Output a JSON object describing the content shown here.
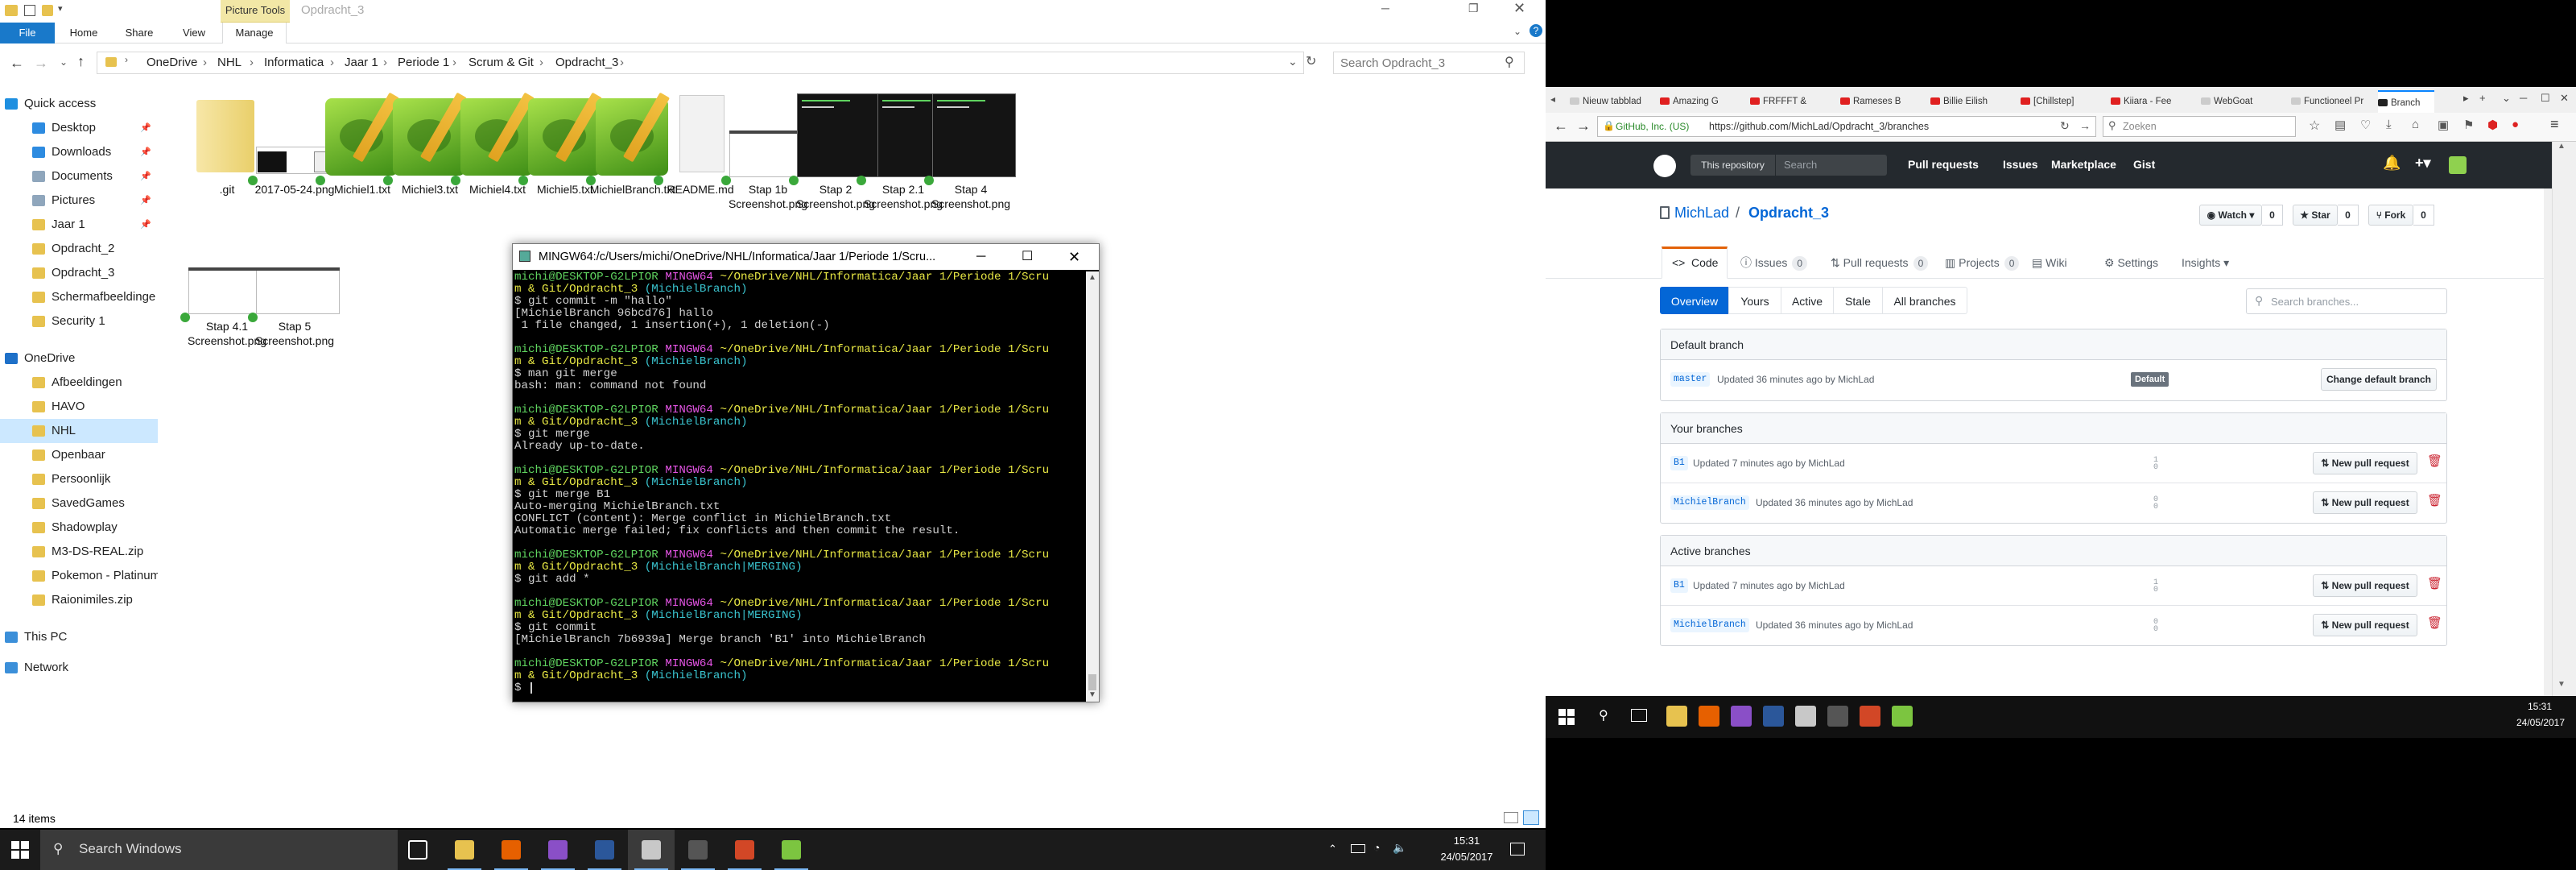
{
  "explorer": {
    "quick_title": "",
    "picture_tools": "Picture Tools",
    "window_title": "Opdracht_3",
    "tabs": [
      "File",
      "Home",
      "Share",
      "View",
      "Manage"
    ],
    "breadcrumb": [
      "OneDrive",
      "NHL",
      "Informatica",
      "Jaar 1",
      "Periode 1",
      "Scrum & Git",
      "Opdracht_3"
    ],
    "search_placeholder": "Search Opdracht_3",
    "nav": [
      {
        "label": "Quick access",
        "icon": "star-icon",
        "color": "#1e8fe0",
        "pin": false
      },
      {
        "label": "Desktop",
        "icon": "desktop-icon",
        "color": "#2d8be0",
        "pin": true
      },
      {
        "label": "Downloads",
        "icon": "download-icon",
        "color": "#2d8be0",
        "pin": true
      },
      {
        "label": "Documents",
        "icon": "documents-icon",
        "color": "#8fa6bc",
        "pin": true
      },
      {
        "label": "Pictures",
        "icon": "pictures-icon",
        "color": "#8fa6bc",
        "pin": true
      },
      {
        "label": "Jaar 1",
        "icon": "folder-icon",
        "color": "#e7c24f",
        "pin": true
      },
      {
        "label": "Opdracht_2",
        "icon": "folder-icon",
        "color": "#e7c24f",
        "pin": false
      },
      {
        "label": "Opdracht_3",
        "icon": "folder-icon",
        "color": "#e7c24f",
        "pin": false
      },
      {
        "label": "Schermafbeeldinge",
        "icon": "folder-icon",
        "color": "#e7c24f",
        "pin": false
      },
      {
        "label": "Security 1",
        "icon": "folder-icon",
        "color": "#e7c24f",
        "pin": false
      },
      {
        "label": "OneDrive",
        "icon": "cloud-icon",
        "color": "#1e70c8",
        "pin": false
      },
      {
        "label": "Afbeeldingen",
        "icon": "folder-icon",
        "color": "#e7c24f",
        "pin": false
      },
      {
        "label": "HAVO",
        "icon": "folder-icon",
        "color": "#e7c24f",
        "pin": false
      },
      {
        "label": "NHL",
        "icon": "folder-icon",
        "color": "#e7c24f",
        "pin": false
      },
      {
        "label": "Openbaar",
        "icon": "folder-icon",
        "color": "#e7c24f",
        "pin": false
      },
      {
        "label": "Persoonlijk",
        "icon": "folder-icon",
        "color": "#e7c24f",
        "pin": false
      },
      {
        "label": "SavedGames",
        "icon": "folder-icon",
        "color": "#e7c24f",
        "pin": false
      },
      {
        "label": "Shadowplay",
        "icon": "folder-icon",
        "color": "#e7c24f",
        "pin": false
      },
      {
        "label": "M3-DS-REAL.zip",
        "icon": "zip-icon",
        "color": "#e7c24f",
        "pin": false
      },
      {
        "label": "Pokemon - Platinum",
        "icon": "zip-icon",
        "color": "#e7c24f",
        "pin": false
      },
      {
        "label": "Raionimiles.zip",
        "icon": "zip-icon",
        "color": "#e7c24f",
        "pin": false
      },
      {
        "label": "This PC",
        "icon": "computer-icon",
        "color": "#3b8fd9",
        "pin": false
      },
      {
        "label": "Network",
        "icon": "network-icon",
        "color": "#3b8fd9",
        "pin": false
      }
    ],
    "files": [
      {
        "name": ".git",
        "kind": "folder"
      },
      {
        "name": "2017-05-24.png",
        "kind": "png"
      },
      {
        "name": "Michiel1.txt",
        "kind": "npp"
      },
      {
        "name": "Michiel3.txt",
        "kind": "npp"
      },
      {
        "name": "Michiel4.txt",
        "kind": "npp"
      },
      {
        "name": "Michiel5.txt",
        "kind": "npp"
      },
      {
        "name": "MichielBranch.txt",
        "kind": "npp"
      },
      {
        "name": "README.md",
        "kind": "doc"
      },
      {
        "name": "Stap 1b Screenshot.png",
        "kind": "shot-light"
      },
      {
        "name": "Stap 2 Screenshot.png",
        "kind": "shot-dark"
      },
      {
        "name": "Stap 2.1 Screenshot.png",
        "kind": "shot-dark"
      },
      {
        "name": "Stap 4 Screenshot.png",
        "kind": "shot-dark"
      },
      {
        "name": "Stap 4.1 Screenshot.png",
        "kind": "shot-light"
      },
      {
        "name": "Stap 5 Screenshot.png",
        "kind": "shot-light"
      }
    ],
    "status_count": "14 items"
  },
  "terminal": {
    "title": "MINGW64:/c/Users/michi/OneDrive/NHL/Informatica/Jaar 1/Periode 1/Scru...",
    "lines": [
      [
        {
          "t": "michi@DESKTOP-G2LPIOR ",
          "c": "tg"
        },
        {
          "t": "MINGW64 ",
          "c": "tm"
        },
        {
          "t": "~/OneDrive/NHL/Informatica/Jaar 1/Periode 1/Scru",
          "c": "ty"
        }
      ],
      [
        {
          "t": "m & Git/Opdracht_3 ",
          "c": "ty"
        },
        {
          "t": "(MichielBranch)",
          "c": "tc"
        }
      ],
      [
        {
          "t": "$ git commit -m \"hallo\"",
          "c": ""
        }
      ],
      [
        {
          "t": "[MichielBranch 96bcd76] hallo",
          "c": ""
        }
      ],
      [
        {
          "t": " 1 file changed, 1 insertion(+), 1 deletion(-)",
          "c": ""
        }
      ],
      [
        {
          "t": "",
          "c": ""
        }
      ],
      [
        {
          "t": "michi@DESKTOP-G2LPIOR ",
          "c": "tg"
        },
        {
          "t": "MINGW64 ",
          "c": "tm"
        },
        {
          "t": "~/OneDrive/NHL/Informatica/Jaar 1/Periode 1/Scru",
          "c": "ty"
        }
      ],
      [
        {
          "t": "m & Git/Opdracht_3 ",
          "c": "ty"
        },
        {
          "t": "(MichielBranch)",
          "c": "tc"
        }
      ],
      [
        {
          "t": "$ man git merge",
          "c": ""
        }
      ],
      [
        {
          "t": "bash: man: command not found",
          "c": ""
        }
      ],
      [
        {
          "t": "",
          "c": ""
        }
      ],
      [
        {
          "t": "michi@DESKTOP-G2LPIOR ",
          "c": "tg"
        },
        {
          "t": "MINGW64 ",
          "c": "tm"
        },
        {
          "t": "~/OneDrive/NHL/Informatica/Jaar 1/Periode 1/Scru",
          "c": "ty"
        }
      ],
      [
        {
          "t": "m & Git/Opdracht_3 ",
          "c": "ty"
        },
        {
          "t": "(MichielBranch)",
          "c": "tc"
        }
      ],
      [
        {
          "t": "$ git merge",
          "c": ""
        }
      ],
      [
        {
          "t": "Already up-to-date.",
          "c": ""
        }
      ],
      [
        {
          "t": "",
          "c": ""
        }
      ],
      [
        {
          "t": "michi@DESKTOP-G2LPIOR ",
          "c": "tg"
        },
        {
          "t": "MINGW64 ",
          "c": "tm"
        },
        {
          "t": "~/OneDrive/NHL/Informatica/Jaar 1/Periode 1/Scru",
          "c": "ty"
        }
      ],
      [
        {
          "t": "m & Git/Opdracht_3 ",
          "c": "ty"
        },
        {
          "t": "(MichielBranch)",
          "c": "tc"
        }
      ],
      [
        {
          "t": "$ git merge B1",
          "c": ""
        }
      ],
      [
        {
          "t": "Auto-merging MichielBranch.txt",
          "c": ""
        }
      ],
      [
        {
          "t": "CONFLICT (content): Merge conflict in MichielBranch.txt",
          "c": ""
        }
      ],
      [
        {
          "t": "Automatic merge failed; fix conflicts and then commit the result.",
          "c": ""
        }
      ],
      [
        {
          "t": "",
          "c": ""
        }
      ],
      [
        {
          "t": "michi@DESKTOP-G2LPIOR ",
          "c": "tg"
        },
        {
          "t": "MINGW64 ",
          "c": "tm"
        },
        {
          "t": "~/OneDrive/NHL/Informatica/Jaar 1/Periode 1/Scru",
          "c": "ty"
        }
      ],
      [
        {
          "t": "m & Git/Opdracht_3 ",
          "c": "ty"
        },
        {
          "t": "(MichielBranch|MERGING)",
          "c": "tc"
        }
      ],
      [
        {
          "t": "$ git add *",
          "c": ""
        }
      ],
      [
        {
          "t": "",
          "c": ""
        }
      ],
      [
        {
          "t": "michi@DESKTOP-G2LPIOR ",
          "c": "tg"
        },
        {
          "t": "MINGW64 ",
          "c": "tm"
        },
        {
          "t": "~/OneDrive/NHL/Informatica/Jaar 1/Periode 1/Scru",
          "c": "ty"
        }
      ],
      [
        {
          "t": "m & Git/Opdracht_3 ",
          "c": "ty"
        },
        {
          "t": "(MichielBranch|MERGING)",
          "c": "tc"
        }
      ],
      [
        {
          "t": "$ git commit",
          "c": ""
        }
      ],
      [
        {
          "t": "[MichielBranch 7b6939a] Merge branch 'B1' into MichielBranch",
          "c": ""
        }
      ],
      [
        {
          "t": "",
          "c": ""
        }
      ],
      [
        {
          "t": "michi@DESKTOP-G2LPIOR ",
          "c": "tg"
        },
        {
          "t": "MINGW64 ",
          "c": "tm"
        },
        {
          "t": "~/OneDrive/NHL/Informatica/Jaar 1/Periode 1/Scru",
          "c": "ty"
        }
      ],
      [
        {
          "t": "m & Git/Opdracht_3 ",
          "c": "ty"
        },
        {
          "t": "(MichielBranch)",
          "c": "tc"
        }
      ],
      [
        {
          "t": "$ ",
          "c": ""
        }
      ]
    ]
  },
  "taskbar": {
    "search_placeholder": "Search Windows",
    "time": "15:31",
    "date": "24/05/2017",
    "apps": [
      {
        "name": "task-view-icon",
        "color": "#ffffff"
      },
      {
        "name": "file-explorer-icon",
        "color": "#e7c24f"
      },
      {
        "name": "firefox-icon",
        "color": "#e66000"
      },
      {
        "name": "visual-studio-icon",
        "color": "#8a4fc7"
      },
      {
        "name": "word-icon",
        "color": "#2b579a"
      },
      {
        "name": "git-icon",
        "color": "#c8c8c8"
      },
      {
        "name": "terminal-icon",
        "color": "#555555"
      },
      {
        "name": "powerpoint-icon",
        "color": "#d24726"
      },
      {
        "name": "notepadpp-icon",
        "color": "#7cc540"
      }
    ]
  },
  "browser": {
    "tabs": [
      "Nieuw tabblad",
      "Amazing G",
      "FRFFFT &",
      "Rameses B",
      "Billie Eilish",
      "[Chillstep]",
      "Kiiara - Fee",
      "WebGoat",
      "Functioneel Pr",
      "Branch"
    ],
    "identity": "GitHub, Inc. (US)",
    "url": "https://github.com/MichLad/Opdracht_3/branches",
    "search_placeholder": "Zoeken"
  },
  "github": {
    "scope": "This repository",
    "search_placeholder": "Search",
    "nav": [
      "Pull requests",
      "Issues",
      "Marketplace",
      "Gist"
    ],
    "owner": "MichLad",
    "sep": "/",
    "repo": "Opdracht_3",
    "watch": "Watch",
    "watch_count": "0",
    "star": "Star",
    "star_count": "0",
    "fork": "Fork",
    "fork_count": "0",
    "tabs": [
      {
        "label": "Code",
        "count": ""
      },
      {
        "label": "Issues",
        "count": "0"
      },
      {
        "label": "Pull requests",
        "count": "0"
      },
      {
        "label": "Projects",
        "count": "0"
      },
      {
        "label": "Wiki",
        "count": ""
      },
      {
        "label": "Settings",
        "count": ""
      },
      {
        "label": "Insights",
        "count": ""
      }
    ],
    "subnav": [
      "Overview",
      "Yours",
      "Active",
      "Stale",
      "All branches"
    ],
    "branch_search_placeholder": "Search branches...",
    "default_section": {
      "title": "Default branch",
      "branch": "master",
      "meta": "Updated 36 minutes ago by MichLad",
      "label": "Default",
      "button": "Change default branch"
    },
    "your_section": {
      "title": "Your branches",
      "rows": [
        {
          "branch": "B1",
          "meta": "Updated 7 minutes ago by MichLad",
          "ab": "1 0",
          "button": "New pull request"
        },
        {
          "branch": "MichielBranch",
          "meta": "Updated 36 minutes ago by MichLad",
          "ab": "0 0",
          "button": "New pull request"
        }
      ]
    },
    "active_section": {
      "title": "Active branches",
      "rows": [
        {
          "branch": "B1",
          "meta": "Updated 7 minutes ago by MichLad",
          "ab": "1 0",
          "button": "New pull request"
        },
        {
          "branch": "MichielBranch",
          "meta": "Updated 36 minutes ago by MichLad",
          "ab": "0 0",
          "button": "New pull request"
        }
      ]
    }
  },
  "right_taskbar": {
    "time": "15:31",
    "date": "24/05/2017"
  }
}
